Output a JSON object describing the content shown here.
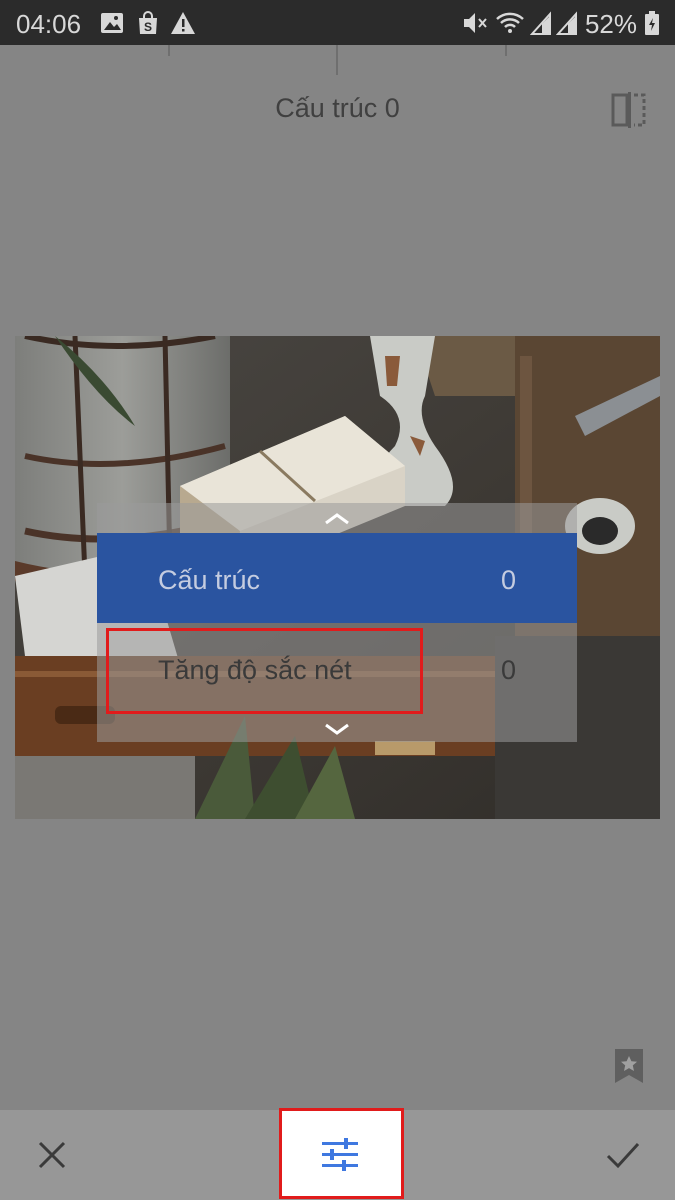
{
  "status_bar": {
    "time": "04:06",
    "battery_percent": "52%"
  },
  "header": {
    "title": "Cấu trúc 0"
  },
  "adjust_menu": {
    "items": [
      {
        "label": "Cấu trúc",
        "value": "0",
        "selected": true
      },
      {
        "label": "Tăng độ sắc nét",
        "value": "0",
        "selected": false
      }
    ]
  },
  "colors": {
    "accent_blue": "#2a54a0",
    "highlight_red": "#e11b1b",
    "tool_icon_blue": "#3f78e0"
  },
  "icons": {
    "close": "close-icon",
    "tools": "tune-sliders-icon",
    "apply": "check-icon",
    "compare": "compare-icon",
    "bookmark": "bookmark-star-icon"
  }
}
